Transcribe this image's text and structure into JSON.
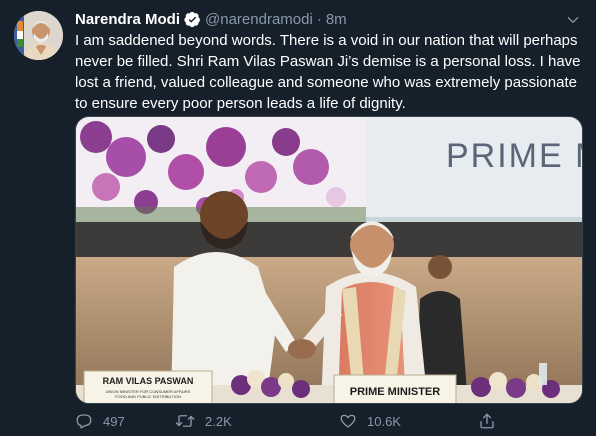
{
  "tweet": {
    "author_name": "Narendra Modi",
    "handle": "@narendramodi",
    "separator": "·",
    "time": "8m",
    "text": "I am saddened beyond words. There is a void in our nation that will perhaps never be filled. Shri Ram Vilas Paswan Ji’s demise is a personal loss. I have lost a friend, valued colleague and someone who was extremely passionate to ensure every poor person leads a life of dignity."
  },
  "photo": {
    "backdrop_text": "PRIME MI",
    "placard_left_name": "RAM VILAS PASWAN",
    "placard_left_sub1": "UNION MINISTER FOR CONSUMER AFFAIRS",
    "placard_left_sub2": "FOOD AND PUBLIC DISTRIBUTION",
    "placard_right": "PRIME MINISTER"
  },
  "actions": {
    "reply_count": "497",
    "retweet_count": "2.2K",
    "like_count": "10.6K"
  },
  "icons": {
    "verified": "verified-badge-icon",
    "caret": "chevron-down-icon",
    "reply": "reply-icon",
    "retweet": "retweet-icon",
    "like": "heart-icon",
    "share": "share-icon"
  },
  "colors": {
    "background": "#15202b",
    "text": "#ffffff",
    "muted": "#8899a6",
    "verified": "#ffffff"
  }
}
